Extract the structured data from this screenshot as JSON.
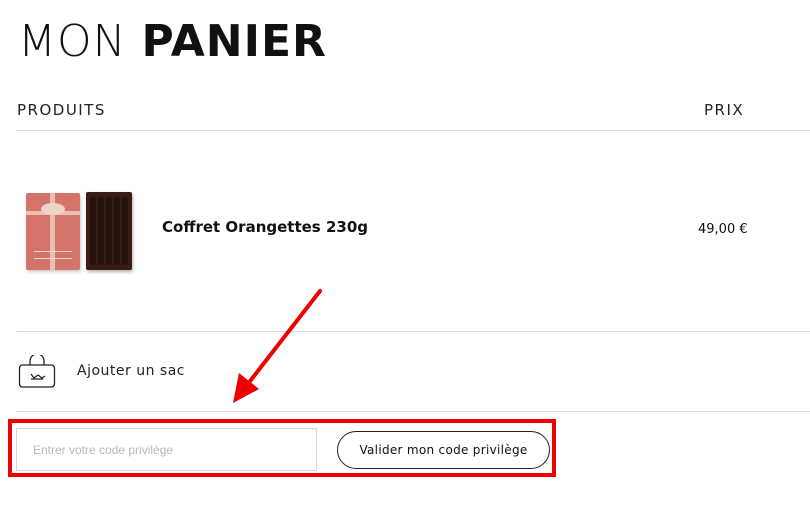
{
  "header": {
    "title_light": "MON",
    "title_bold": "PANIER"
  },
  "table": {
    "col_products": "PRODUITS",
    "col_price": "PRIX"
  },
  "cart": {
    "items": [
      {
        "name": "Coffret Orangettes 230g",
        "price": "49,00 €"
      }
    ]
  },
  "bag": {
    "label": "Ajouter un sac",
    "icon": "shopping-bag-icon"
  },
  "promo": {
    "placeholder": "Entrer votre code privilège",
    "value": "",
    "button_label": "Valider mon code privilège",
    "highlight_color": "#ee0000"
  },
  "annotation": {
    "arrow_color": "#ee0000"
  }
}
